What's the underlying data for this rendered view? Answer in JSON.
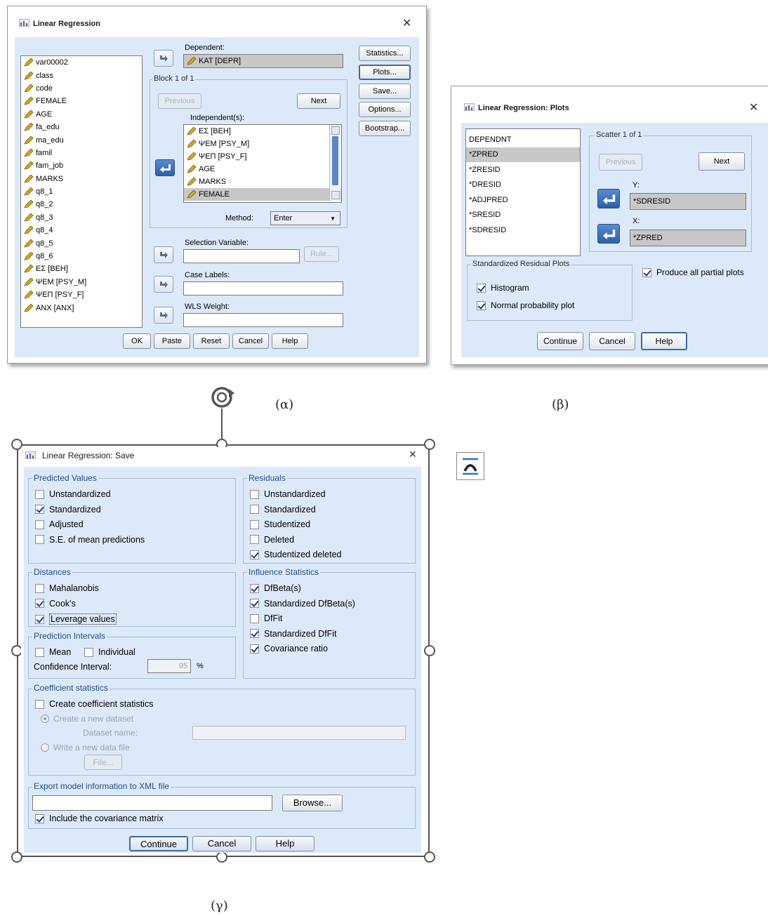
{
  "colors": {
    "panel": "#dce9f8",
    "selection": "#c8c8c8",
    "accent_blue": "#2d5fa9"
  },
  "dialog_a": {
    "title": "Linear Regression",
    "variables": [
      "var00002",
      "class",
      "code",
      "FEMALE",
      "AGE",
      "fa_edu",
      "ma_edu",
      "famil",
      "fam_job",
      "MARKS",
      "q8_1",
      "q8_2",
      "q8_3",
      "q8_4",
      "q8_5",
      "q8_6",
      "ΕΣ [BEH]",
      "ΨΕΜ [PSY_M]",
      "ΨΕΠ [PSY_F]",
      "ANX [ANX]"
    ],
    "dependent_label": "Dependent:",
    "dependent_value": "KAT [DEPR]",
    "block_label": "Block 1 of 1",
    "previous": "Previous",
    "next": "Next",
    "independents_label": "Independent(s):",
    "independents": [
      "ΕΣ [BEH]",
      "ΨΕΜ [PSY_M]",
      "ΨΕΠ [PSY_F]",
      "AGE",
      "MARKS",
      "FEMALE"
    ],
    "method_label": "Method:",
    "method_value": "Enter",
    "selection_label": "Selection Variable:",
    "rule": "Rule...",
    "case_labels": "Case Labels:",
    "wls_label": "WLS Weight:",
    "side_buttons": [
      "Statistics...",
      "Plots...",
      "Save...",
      "Options...",
      "Bootstrap..."
    ],
    "bottom_buttons": [
      "OK",
      "Paste",
      "Reset",
      "Cancel",
      "Help"
    ]
  },
  "dialog_b": {
    "title": "Linear Regression: Plots",
    "list": [
      "DEPENDNT",
      "*ZPRED",
      "*ZRESID",
      "*DRESID",
      "*ADJPRED",
      "*SRESID",
      "*SDRESID"
    ],
    "scatter_label": "Scatter 1 of 1",
    "previous": "Previous",
    "next": "Next",
    "y_label": "Y:",
    "y_value": "*SDRESID",
    "x_label": "X:",
    "x_value": "*ZPRED",
    "std_group": "Standardized Residual Plots",
    "histogram": "Histogram",
    "normal": "Normal probability plot",
    "partial": "Produce all partial plots",
    "buttons": [
      "Continue",
      "Cancel",
      "Help"
    ]
  },
  "dialog_c": {
    "title": "Linear Regression: Save",
    "predicted": {
      "label": "Predicted Values",
      "items": [
        {
          "text": "Unstandardized",
          "checked": false
        },
        {
          "text": "Standardized",
          "checked": true
        },
        {
          "text": "Adjusted",
          "checked": false
        },
        {
          "text": "S.E. of mean predictions",
          "checked": false
        }
      ]
    },
    "residuals": {
      "label": "Residuals",
      "items": [
        {
          "text": "Unstandardized",
          "checked": false
        },
        {
          "text": "Standardized",
          "checked": false
        },
        {
          "text": "Studentized",
          "checked": false
        },
        {
          "text": "Deleted",
          "checked": false
        },
        {
          "text": "Studentized deleted",
          "checked": true
        }
      ]
    },
    "distances": {
      "label": "Distances",
      "items": [
        {
          "text": "Mahalanobis",
          "checked": false
        },
        {
          "text": "Cook's",
          "checked": true
        },
        {
          "text": "Leverage values",
          "checked": true
        }
      ]
    },
    "influence": {
      "label": "Influence Statistics",
      "items": [
        {
          "text": "DfBeta(s)",
          "checked": true
        },
        {
          "text": "Standardized DfBeta(s)",
          "checked": true
        },
        {
          "text": "DfFit",
          "checked": false
        },
        {
          "text": "Standardized DfFit",
          "checked": true
        },
        {
          "text": "Covariance ratio",
          "checked": true
        }
      ]
    },
    "prediction": {
      "label": "Prediction Intervals",
      "mean": "Mean",
      "individual": "Individual",
      "ci_label": "Confidence Interval:",
      "ci_value": "95",
      "ci_unit": "%"
    },
    "coef": {
      "label": "Coefficient statistics",
      "create": "Create coefficient statistics",
      "new_dataset": "Create a new dataset",
      "dataset_name": "Dataset name:",
      "write_file": "Write a new data file",
      "file": "File..."
    },
    "export": {
      "label": "Export model information to XML file",
      "browse": "Browse...",
      "include": "Include the covariance matrix"
    },
    "buttons": [
      "Continue",
      "Cancel",
      "Help"
    ]
  },
  "captions": {
    "a": "(α)",
    "b": "(β)",
    "c": "(γ)"
  }
}
